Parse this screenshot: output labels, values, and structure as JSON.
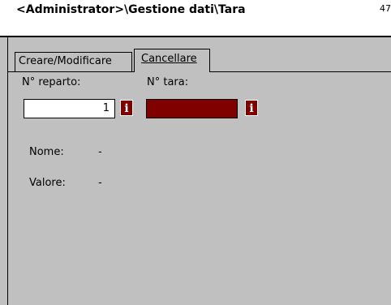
{
  "window": {
    "title": "<Administrator>\\Gestione dati\\Tara",
    "title_right": "47"
  },
  "tabs": [
    {
      "label": "Creare/Modificare",
      "active": false
    },
    {
      "label": "Cancellare",
      "active": true
    }
  ],
  "form": {
    "dept_label": "N° reparto:",
    "dept_value": "1",
    "tare_label": "N° tara:",
    "tare_value": "",
    "info_icon": "i",
    "name_label": "Nome:",
    "name_value": "-",
    "value_label": "Valore:",
    "value_value": "-"
  },
  "colors": {
    "workarea": "#c0c0c0",
    "active_field": "#800000",
    "info_button": "#800000"
  },
  "icons": [
    "info-icon"
  ]
}
